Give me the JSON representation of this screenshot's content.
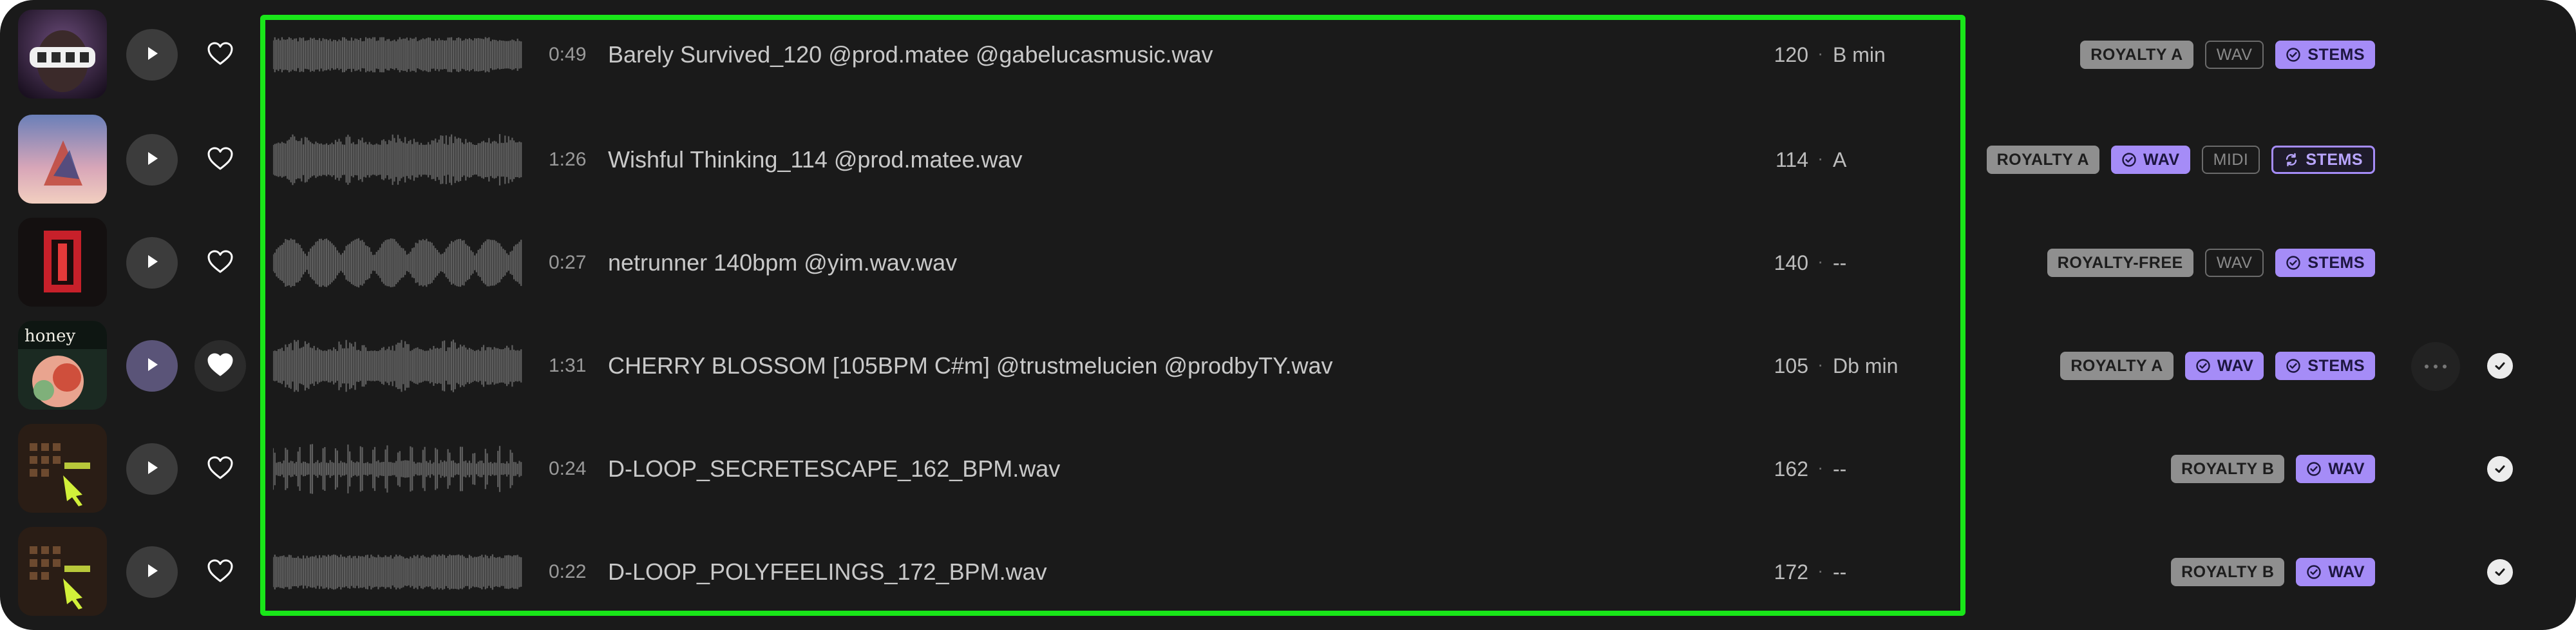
{
  "colors": {
    "panel_bg": "#1a1a1a",
    "accent_purple": "#a58cf7",
    "tag_gray": "#8f8f8f",
    "highlight_border": "#19e619"
  },
  "tracks": [
    {
      "duration": "0:49",
      "title": "Barely Survived_120 @prod.matee @gabelucasmusic.wav",
      "bpm": "120",
      "key": "B min",
      "tags": [
        {
          "label": "ROYALTY A",
          "style": "gray"
        },
        {
          "label": "WAV",
          "style": "outline"
        },
        {
          "label": "STEMS",
          "style": "purple",
          "icon": "check-circle-icon"
        }
      ],
      "liked": false,
      "playing": false,
      "downloaded": false
    },
    {
      "duration": "1:26",
      "title": "Wishful Thinking_114 @prod.matee.wav",
      "bpm": "114",
      "key": "A",
      "tags": [
        {
          "label": "ROYALTY A",
          "style": "gray"
        },
        {
          "label": "WAV",
          "style": "purple",
          "icon": "check-circle-icon"
        },
        {
          "label": "MIDI",
          "style": "outline"
        },
        {
          "label": "STEMS",
          "style": "purple-outline",
          "icon": "loop-icon"
        }
      ],
      "liked": false,
      "playing": false,
      "downloaded": false
    },
    {
      "duration": "0:27",
      "title": "netrunner 140bpm @yim.wav.wav",
      "bpm": "140",
      "key": "--",
      "tags": [
        {
          "label": "ROYALTY-FREE",
          "style": "gray"
        },
        {
          "label": "WAV",
          "style": "outline"
        },
        {
          "label": "STEMS",
          "style": "purple",
          "icon": "check-circle-icon"
        }
      ],
      "liked": false,
      "playing": false,
      "downloaded": false
    },
    {
      "duration": "1:31",
      "title": "CHERRY BLOSSOM [105BPM C#m] @trustmelucien @prodbyTY.wav",
      "bpm": "105",
      "key": "Db min",
      "tags": [
        {
          "label": "ROYALTY A",
          "style": "gray"
        },
        {
          "label": "WAV",
          "style": "purple",
          "icon": "check-circle-icon"
        },
        {
          "label": "STEMS",
          "style": "purple",
          "icon": "check-circle-icon"
        }
      ],
      "liked": true,
      "playing": true,
      "downloaded": true
    },
    {
      "duration": "0:24",
      "title": "D-LOOP_SECRETESCAPE_162_BPM.wav",
      "bpm": "162",
      "key": "--",
      "tags": [
        {
          "label": "ROYALTY B",
          "style": "gray"
        },
        {
          "label": "WAV",
          "style": "purple",
          "icon": "check-circle-icon"
        }
      ],
      "liked": false,
      "playing": false,
      "downloaded": true
    },
    {
      "duration": "0:22",
      "title": "D-LOOP_POLYFEELINGS_172_BPM.wav",
      "bpm": "172",
      "key": "--",
      "tags": [
        {
          "label": "ROYALTY B",
          "style": "gray"
        },
        {
          "label": "WAV",
          "style": "purple",
          "icon": "check-circle-icon"
        }
      ],
      "liked": false,
      "playing": false,
      "downloaded": true
    }
  ],
  "separator": "·"
}
